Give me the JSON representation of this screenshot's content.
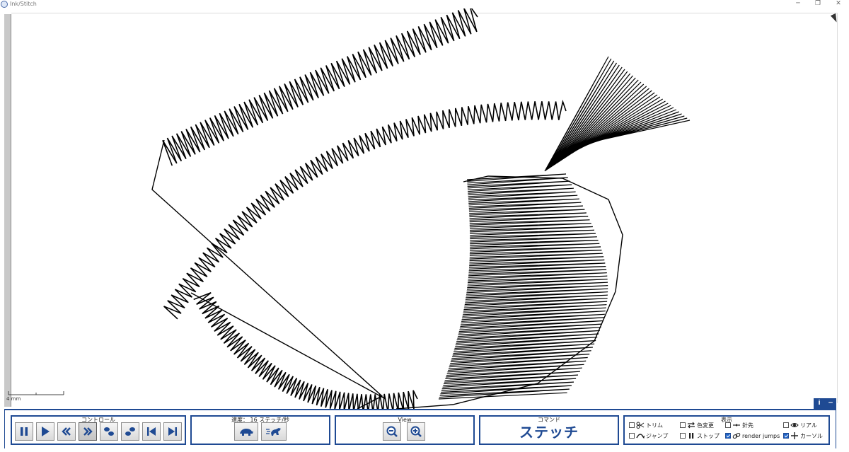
{
  "window": {
    "title": "Ink/Stitch",
    "controls": {
      "minimize": "─",
      "restore": "❐",
      "close": "✕"
    }
  },
  "canvas": {
    "scale_label": "4 mm",
    "info_label": "i",
    "collapse_label": "−",
    "stitch_color": "#000000"
  },
  "panel": {
    "accent_color": "#1f4a93",
    "controls": {
      "label": "コントロール",
      "buttons": [
        "pause-icon",
        "play-icon",
        "rewind-icon",
        "fast-forward-icon",
        "step-back-icon",
        "step-forward-icon",
        "skip-to-start-icon",
        "skip-to-end-icon"
      ]
    },
    "speed": {
      "label": "速度： 16 ステッチ/秒",
      "buttons": [
        "slow-animal-icon",
        "fast-animal-icon"
      ]
    },
    "view": {
      "label": "View",
      "buttons": [
        "zoom-out-icon",
        "zoom-in-icon"
      ]
    },
    "command": {
      "label": "コマンド",
      "value": "ステッチ"
    },
    "display": {
      "label": "表示",
      "options": [
        {
          "label": "トリム",
          "checked": false,
          "icon": "scissors-icon"
        },
        {
          "label": "ジャンプ",
          "checked": false,
          "icon": "jump-icon"
        },
        {
          "label": "色変更",
          "checked": false,
          "icon": "color-change-icon"
        },
        {
          "label": "ストップ",
          "checked": false,
          "icon": "stop-icon"
        },
        {
          "label": "針先",
          "checked": false,
          "icon": "needle-icon"
        },
        {
          "label": "render jumps",
          "checked": true,
          "icon": "link-icon"
        },
        {
          "label": "リアル",
          "checked": false,
          "icon": "eye-icon"
        },
        {
          "label": "カーソル",
          "checked": true,
          "icon": "crosshair-icon"
        }
      ]
    }
  }
}
